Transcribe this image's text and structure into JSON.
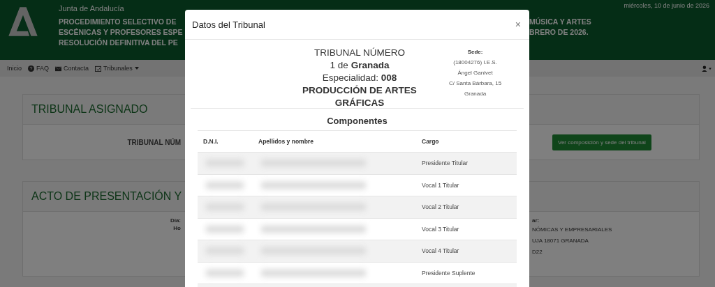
{
  "header": {
    "org": "Junta de Andalucía",
    "date": "miércoles, 10 de junio de 2026",
    "title_left": [
      "PROCEDIMIENTO SELECTIVO DE",
      "ESCÉNICAS Y PROFESORES ESPE",
      "RESOLUCIÓN DEFINITIVA DEL PE"
    ],
    "title_right": [
      "MÚSICA Y ARTES",
      "BRERO DE 2026."
    ]
  },
  "nav": {
    "items": [
      {
        "label": "Inicio",
        "kind": "plain"
      },
      {
        "label": "FAQ",
        "kind": "help"
      },
      {
        "label": "Contacta",
        "kind": "mail"
      },
      {
        "label": "Tribunales",
        "kind": "calendar",
        "dropdown": true
      }
    ]
  },
  "card_tribunal": {
    "title": "TRIBUNAL ASIGNADO",
    "label": "TRIBUNAL NÚM",
    "button": "Ver composición y sede del tribunal"
  },
  "card_acto": {
    "title": "ACTO DE PRESENTACIÓN Y",
    "left_lines": [
      "Día:",
      "Ho"
    ],
    "right_label": "ar:",
    "right_lines": [
      "NÓMICAS Y EMPRESARIALES",
      "UJA 18071 GRANADA",
      "D22"
    ]
  },
  "modal": {
    "title": "Datos del Tribunal",
    "close": "×",
    "tribunal_lines": [
      "TRIBUNAL NÚMERO",
      "1 de **Granada**",
      "Especialidad: **008 PRODUCCIÓN DE ARTES GRÁFICAS**"
    ],
    "sede_label": "Sede:",
    "sede_lines": [
      "(18004276) I.E.S.",
      "Ángel Ganivet",
      "C/ Santa Bárbara, 15",
      "Granada"
    ],
    "section_title": "Componentes",
    "columns": [
      "D.N.I.",
      "Apellidos y nombre",
      "Cargo"
    ],
    "rows": [
      {
        "cargo": "Presidente Titular"
      },
      {
        "cargo": "Vocal 1 Titular"
      },
      {
        "cargo": "Vocal 2 Titular"
      },
      {
        "cargo": "Vocal 3 Titular"
      },
      {
        "cargo": "Vocal 4 Titular"
      },
      {
        "cargo": "Presidente Suplente"
      }
    ]
  }
}
